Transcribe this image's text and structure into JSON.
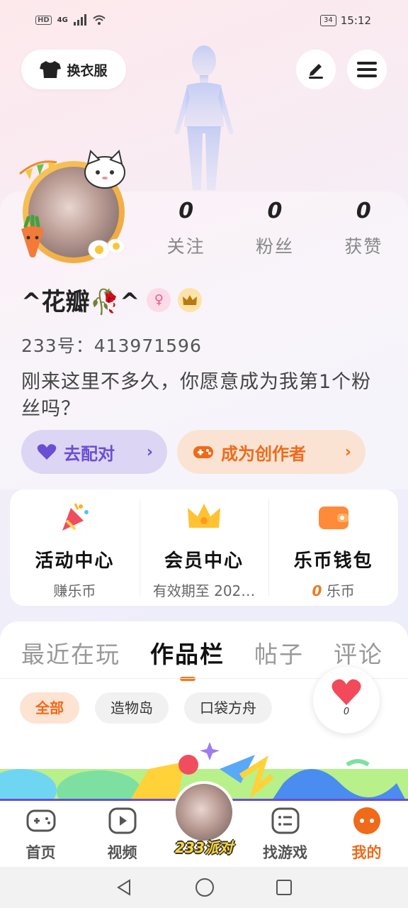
{
  "status_bar": {
    "network_badge": "HD",
    "network_type": "4G",
    "battery": "34",
    "time": "15:12"
  },
  "header": {
    "dress_up_label": "换衣服",
    "edit_icon": "pencil-icon",
    "menu_icon": "menu-icon"
  },
  "profile": {
    "stats": [
      {
        "value": "0",
        "label": "关注"
      },
      {
        "value": "0",
        "label": "粉丝"
      },
      {
        "value": "0",
        "label": "获赞"
      }
    ],
    "nickname": "^花瓣🥀^",
    "uid": "233号：413971596",
    "bio": "刚来这里不多久，你愿意成为我第1个粉丝吗？"
  },
  "actions": {
    "match_label": "去配对",
    "creator_label": "成为创作者"
  },
  "services": [
    {
      "title": "活动中心",
      "subtitle": "赚乐币"
    },
    {
      "title": "会员中心",
      "subtitle": "有效期至 202…"
    },
    {
      "title": "乐币钱包",
      "coin_value": "0",
      "subtitle": "乐币"
    }
  ],
  "tabs": [
    "最近在玩",
    "作品栏",
    "帖子",
    "评论"
  ],
  "active_tab": "作品栏",
  "chips": [
    "全部",
    "造物岛",
    "口袋方舟"
  ],
  "like_count": "0",
  "bottom_nav": [
    {
      "label": "首页"
    },
    {
      "label": "视频"
    },
    {
      "label": "233派对"
    },
    {
      "label": "找游戏"
    },
    {
      "label": "我的"
    }
  ],
  "colors": {
    "accent_orange": "#f06a1a",
    "accent_purple": "#6a4fd4"
  }
}
